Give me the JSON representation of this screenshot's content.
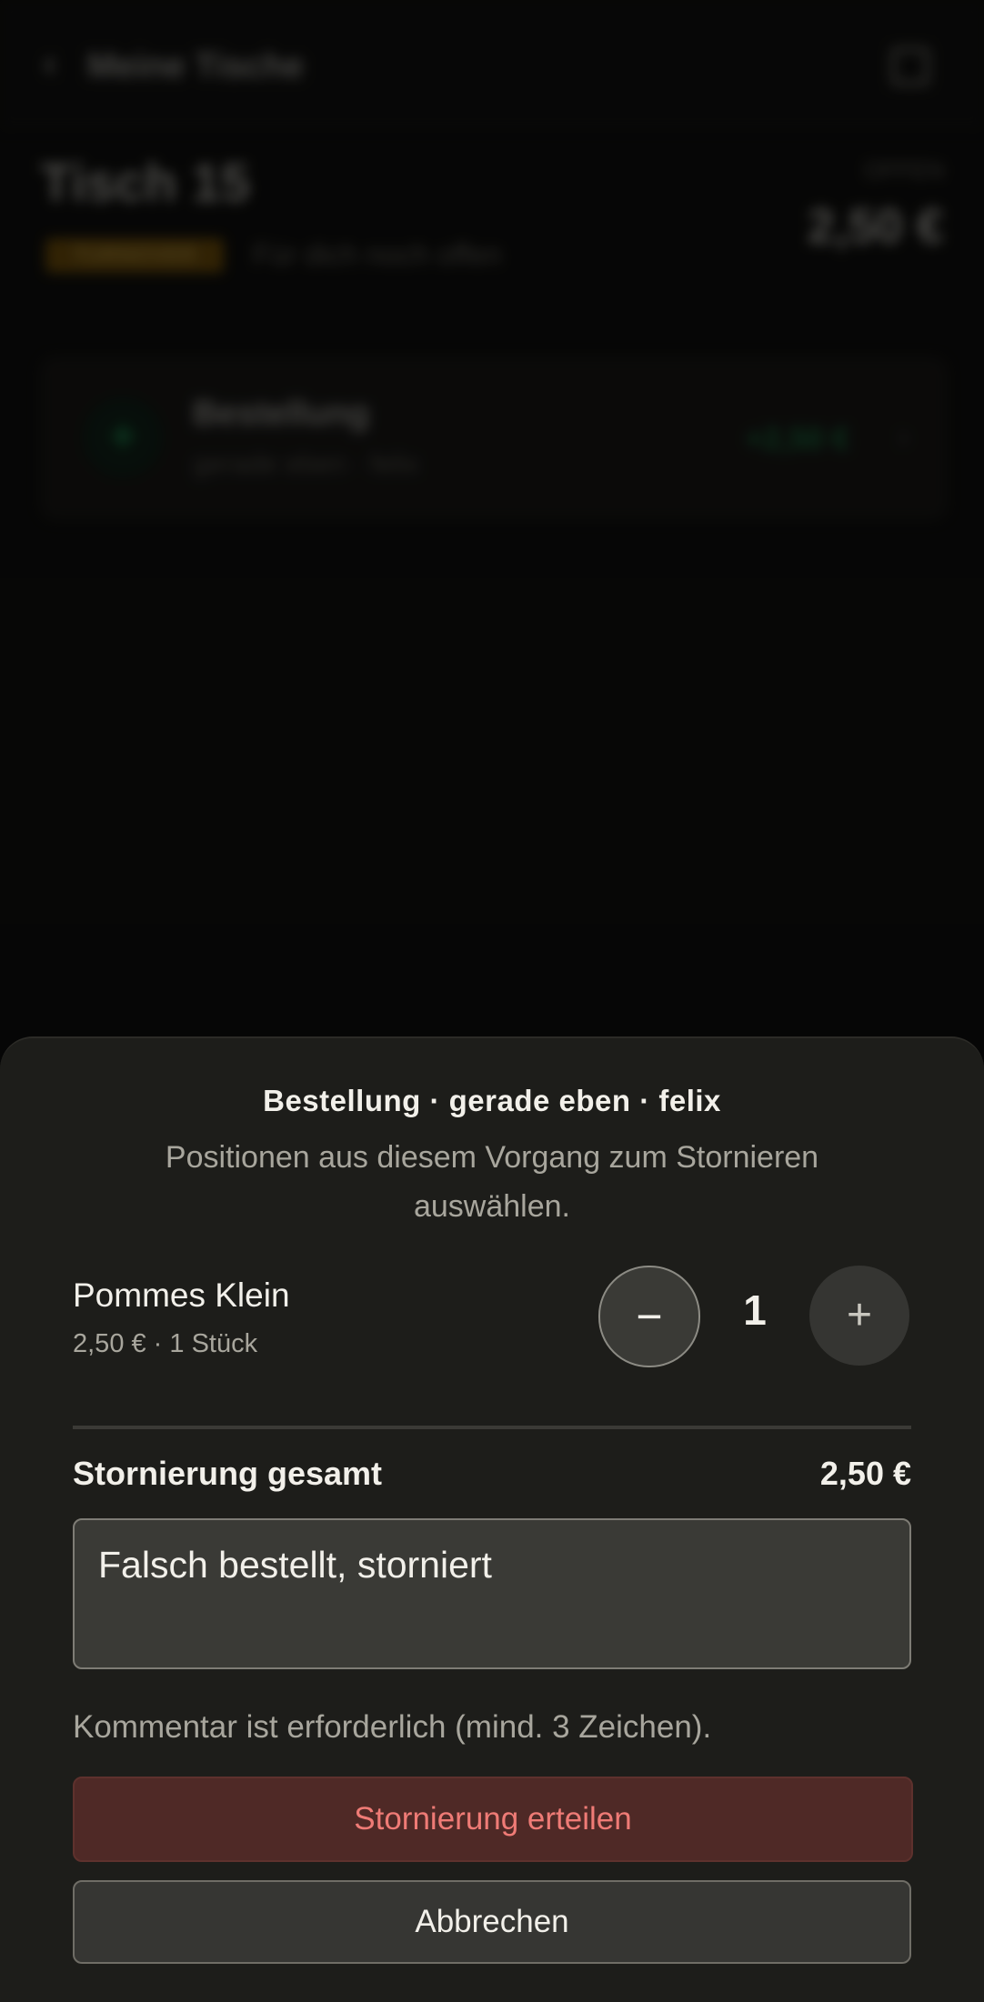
{
  "background": {
    "header": {
      "back_icon": "chevron-left-icon",
      "back_label": "Meine Tische",
      "action_icon": "square-icon"
    },
    "table": {
      "title": "Tisch 15",
      "status_badge": "TURNOVER",
      "status_text": "Für dich noch offen",
      "total_label": "OFFEN",
      "total_value": "2,50 €"
    },
    "transaction": {
      "icon": "plus-icon",
      "title": "Bestellung",
      "subtitle": "gerade eben · felix",
      "amount": "+2,50 €",
      "chevron_icon": "chevron-right-icon"
    }
  },
  "sheet": {
    "title": "Bestellung · gerade eben · felix",
    "subtitle": "Positionen aus diesem Vorgang zum Stornieren auswählen.",
    "item": {
      "name": "Pommes Klein",
      "meta": "2,50 € · 1 Stück",
      "quantity": "1",
      "minus_symbol": "−",
      "plus_symbol": "+"
    },
    "total_label": "Stornierung gesamt",
    "total_value": "2,50 €",
    "comment": {
      "value": "Falsch bestellt, storniert"
    },
    "hint": "Kommentar ist erforderlich (mind. 3 Zeichen).",
    "confirm_label": "Stornierung erteilen",
    "cancel_label": "Abbrechen"
  },
  "colors": {
    "sheet_bg": "#1d1d1a",
    "danger_bg": "#4f2926",
    "danger_text": "#ef7b76",
    "success": "#26c06b",
    "warning": "#f2c14a"
  }
}
